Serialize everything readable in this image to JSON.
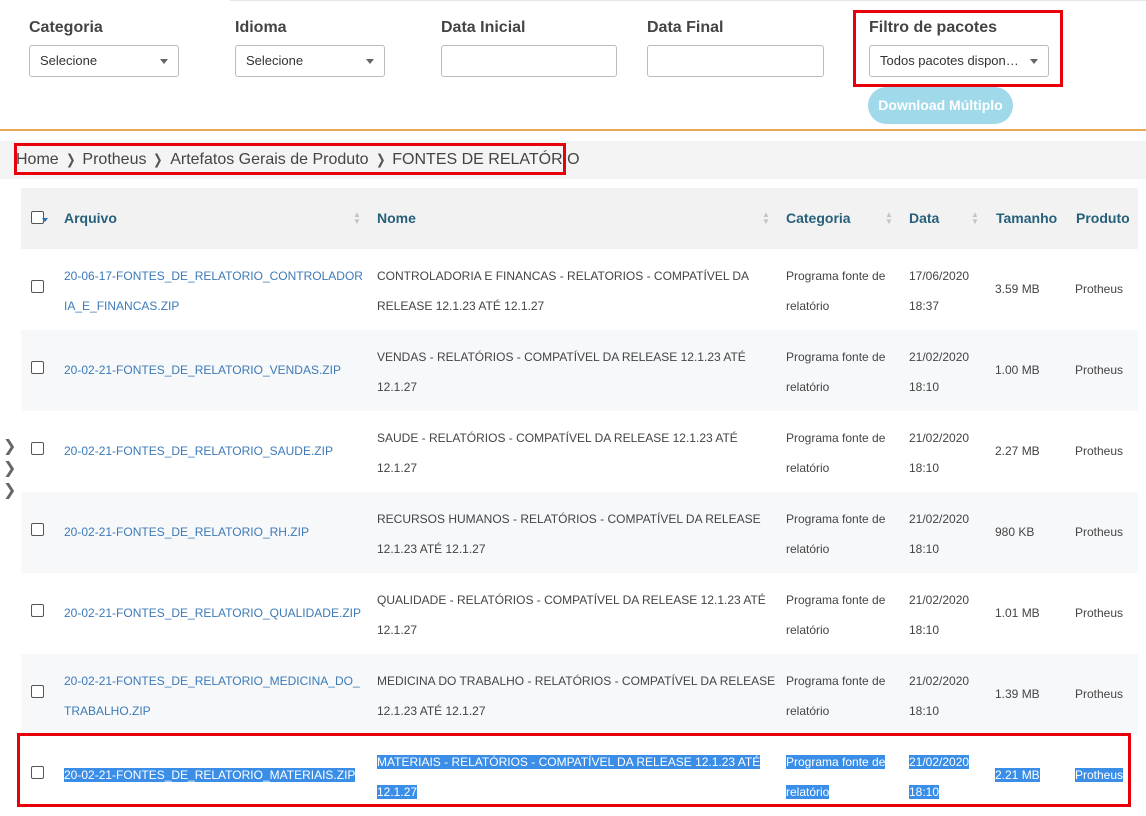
{
  "filters": {
    "categoria": {
      "label": "Categoria",
      "value": "Selecione"
    },
    "idioma": {
      "label": "Idioma",
      "value": "Selecione"
    },
    "data_inicial": {
      "label": "Data Inicial",
      "value": ""
    },
    "data_final": {
      "label": "Data Final",
      "value": ""
    },
    "filtro_pacotes": {
      "label": "Filtro de pacotes",
      "value": "Todos pacotes disponí…"
    },
    "download_label": "Download Múltiplo"
  },
  "breadcrumb": {
    "items": [
      "Home",
      "Protheus",
      "Artefatos Gerais de Produto",
      "FONTES DE RELATÓRIO"
    ],
    "separator": "❯"
  },
  "table": {
    "columns": [
      "Arquivo",
      "Nome",
      "Categoria",
      "Data",
      "Tamanho",
      "Produto"
    ],
    "rows": [
      {
        "file": [
          "20-06-17-FONTES_DE_RELATORIO_CONTROLADOR",
          "IA_E_FINANCAS.ZIP"
        ],
        "nome": [
          "CONTROLADORIA E FINANCAS - RELATORIOS - COMPATÍVEL DA",
          "RELEASE 12.1.23 ATÉ 12.1.27"
        ],
        "categoria": [
          "Programa fonte de",
          "relatório"
        ],
        "data": [
          "17/06/2020",
          "18:37"
        ],
        "tamanho": "3.59 MB",
        "produto": "Protheus"
      },
      {
        "file": [
          "20-02-21-FONTES_DE_RELATORIO_VENDAS.ZIP"
        ],
        "nome": [
          "VENDAS - RELATÓRIOS - COMPATÍVEL DA RELEASE 12.1.23 ATÉ",
          "12.1.27"
        ],
        "categoria": [
          "Programa fonte de",
          "relatório"
        ],
        "data": [
          "21/02/2020",
          "18:10"
        ],
        "tamanho": "1.00 MB",
        "produto": "Protheus"
      },
      {
        "file": [
          "20-02-21-FONTES_DE_RELATORIO_SAUDE.ZIP"
        ],
        "nome": [
          "SAUDE - RELATÓRIOS - COMPATÍVEL DA RELEASE 12.1.23 ATÉ",
          "12.1.27"
        ],
        "categoria": [
          "Programa fonte de",
          "relatório"
        ],
        "data": [
          "21/02/2020",
          "18:10"
        ],
        "tamanho": "2.27 MB",
        "produto": "Protheus"
      },
      {
        "file": [
          "20-02-21-FONTES_DE_RELATORIO_RH.ZIP"
        ],
        "nome": [
          "RECURSOS HUMANOS - RELATÓRIOS - COMPATÍVEL DA RELEASE",
          "12.1.23 ATÉ 12.1.27"
        ],
        "categoria": [
          "Programa fonte de",
          "relatório"
        ],
        "data": [
          "21/02/2020",
          "18:10"
        ],
        "tamanho": "980 KB",
        "produto": "Protheus"
      },
      {
        "file": [
          "20-02-21-FONTES_DE_RELATORIO_QUALIDADE.ZIP"
        ],
        "nome": [
          "QUALIDADE - RELATÓRIOS - COMPATÍVEL DA RELEASE 12.1.23 ATÉ",
          "12.1.27"
        ],
        "categoria": [
          "Programa fonte de",
          "relatório"
        ],
        "data": [
          "21/02/2020",
          "18:10"
        ],
        "tamanho": "1.01 MB",
        "produto": "Protheus"
      },
      {
        "file": [
          "20-02-21-FONTES_DE_RELATORIO_MEDICINA_DO_",
          "TRABALHO.ZIP"
        ],
        "nome": [
          "MEDICINA DO TRABALHO - RELATÓRIOS - COMPATÍVEL DA RELEASE",
          "12.1.23 ATÉ 12.1.27"
        ],
        "categoria": [
          "Programa fonte de",
          "relatório"
        ],
        "data": [
          "21/02/2020",
          "18:10"
        ],
        "tamanho": "1.39 MB",
        "produto": "Protheus"
      },
      {
        "file": [
          "20-02-21-FONTES_DE_RELATORIO_MATERIAIS.ZIP"
        ],
        "nome": [
          "MATERIAIS - RELATÓRIOS - COMPATÍVEL DA RELEASE 12.1.23 ATÉ",
          "12.1.27"
        ],
        "categoria": [
          "Programa fonte de",
          "relatório"
        ],
        "data": [
          "21/02/2020",
          "18:10"
        ],
        "tamanho": "2.21 MB",
        "produto": "Protheus",
        "selected": true
      }
    ]
  },
  "side_arrows": [
    "❯",
    "❯",
    "❯"
  ],
  "colors": {
    "highlight_box": "#e8000b",
    "accent_line": "#e8a95b",
    "link": "#3c7ab8",
    "header_text": "#26607a",
    "selection": "#3a8ee8",
    "download_button": "#9fd9ea"
  }
}
